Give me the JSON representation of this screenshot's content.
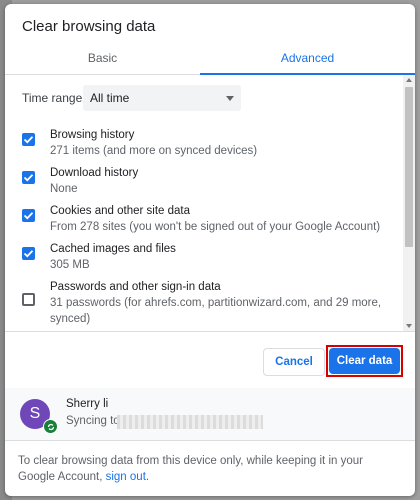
{
  "dialog": {
    "title": "Clear browsing data"
  },
  "tabs": [
    {
      "label": "Basic"
    },
    {
      "label": "Advanced"
    }
  ],
  "time_range": {
    "label": "Time range",
    "value": "All time"
  },
  "items": [
    {
      "title": "Browsing history",
      "desc": "271 items (and more on synced devices)",
      "checked": true
    },
    {
      "title": "Download history",
      "desc": "None",
      "checked": true
    },
    {
      "title": "Cookies and other site data",
      "desc": "From 278 sites (you won't be signed out of your Google Account)",
      "checked": true
    },
    {
      "title": "Cached images and files",
      "desc": "305 MB",
      "checked": true
    },
    {
      "title": "Passwords and other sign-in data",
      "desc": "31 passwords (for ahrefs.com, partitionwizard.com, and 29 more, synced)",
      "checked": false
    }
  ],
  "buttons": {
    "cancel": "Cancel",
    "clear": "Clear data"
  },
  "account": {
    "initial": "S",
    "name": "Sherry li",
    "syncing_prefix": "Syncing to"
  },
  "footer": {
    "text": "To clear browsing data from this device only, while keeping it in your Google Account,",
    "link": "sign out",
    "suffix": "."
  },
  "colors": {
    "accent": "#1a73e8",
    "highlight": "#d50000",
    "avatar": "#6f47b8",
    "sync": "#188038"
  }
}
